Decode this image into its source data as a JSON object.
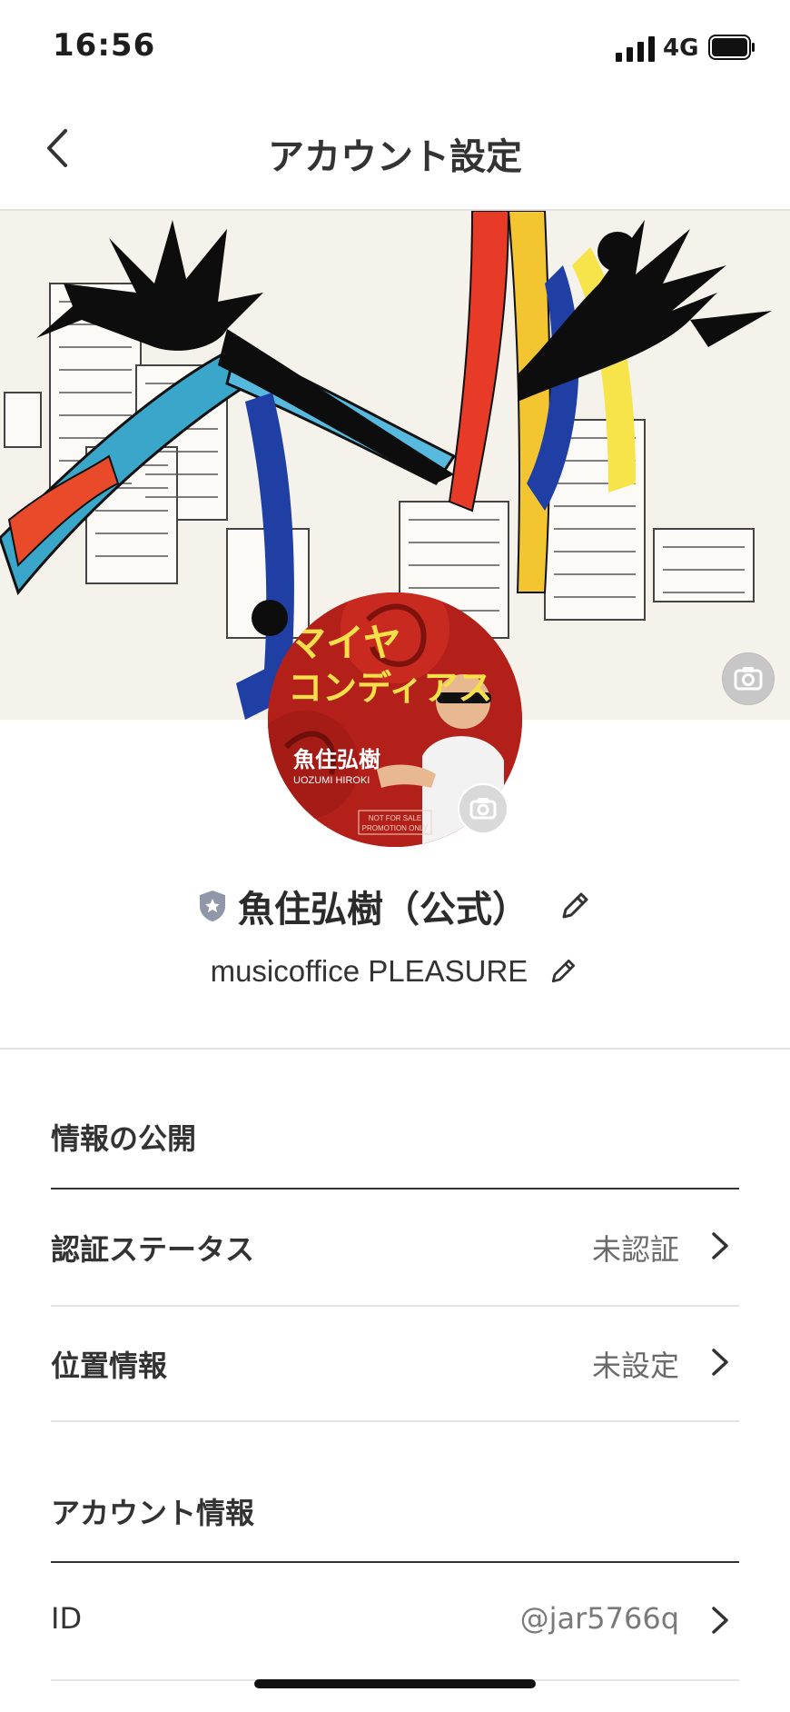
{
  "status_bar": {
    "time": "16:56",
    "network": "4G"
  },
  "header": {
    "title": "アカウント設定",
    "back_icon": "chevron-left-icon"
  },
  "profile": {
    "name": "魚住弘樹（公式）",
    "subtitle": "musicoffice PLEASURE",
    "avatar_text": {
      "title_line1": "マイヤ",
      "title_line2": "コンディアス",
      "artist": "魚住弘樹",
      "artist_romaji": "UOZUMI HIROKI",
      "promo_line1": "NOT FOR SALE",
      "promo_line2": "PROMOTION ONLY"
    }
  },
  "sections": {
    "public_info": {
      "heading": "情報の公開",
      "rows": [
        {
          "label": "認証ステータス",
          "value": "未認証"
        },
        {
          "label": "位置情報",
          "value": "未設定"
        }
      ]
    },
    "account_info": {
      "heading": "アカウント情報",
      "rows": [
        {
          "label": "ID",
          "value": "@jar5766q"
        }
      ]
    }
  },
  "colors": {
    "accent_red": "#b3201a",
    "title_yellow": "#f6e04a"
  }
}
